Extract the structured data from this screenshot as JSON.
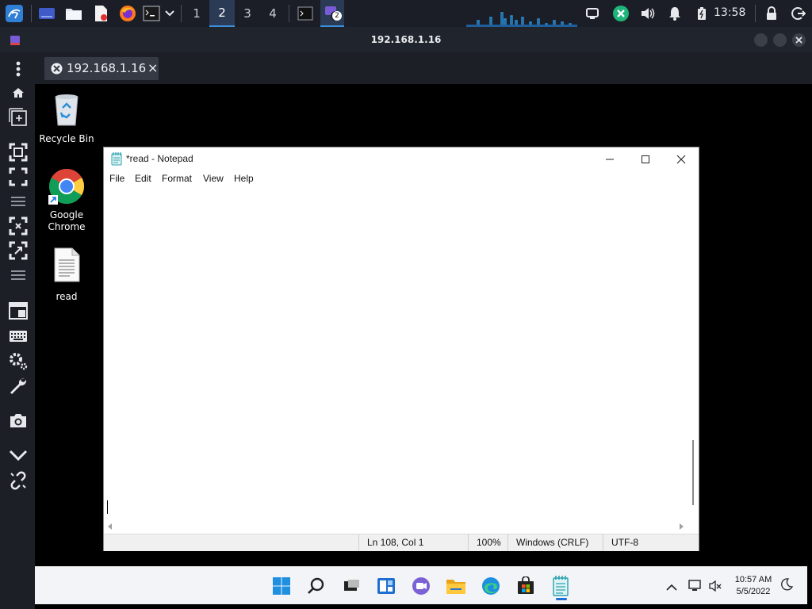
{
  "top_panel": {
    "workspaces": [
      "1",
      "2",
      "3",
      "4"
    ],
    "active_workspace": "2",
    "clock": "13:58",
    "task_badge": "2"
  },
  "viewer": {
    "title": "192.168.1.16",
    "tab_label": "192.168.1.16",
    "tab_close": "×"
  },
  "desktop": {
    "icons": [
      {
        "label": "Recycle Bin",
        "icon": "recycle-bin-icon"
      },
      {
        "label": "Google Chrome",
        "icon": "chrome-icon"
      },
      {
        "label": "read",
        "icon": "text-file-icon"
      }
    ]
  },
  "notepad": {
    "title": "*read - Notepad",
    "menu": [
      "File",
      "Edit",
      "Format",
      "View",
      "Help"
    ],
    "status": {
      "position": "Ln 108, Col 1",
      "zoom": "100%",
      "line_endings": "Windows (CRLF)",
      "encoding": "UTF-8"
    }
  },
  "taskbar": {
    "time": "10:57 AM",
    "date": "5/5/2022"
  }
}
